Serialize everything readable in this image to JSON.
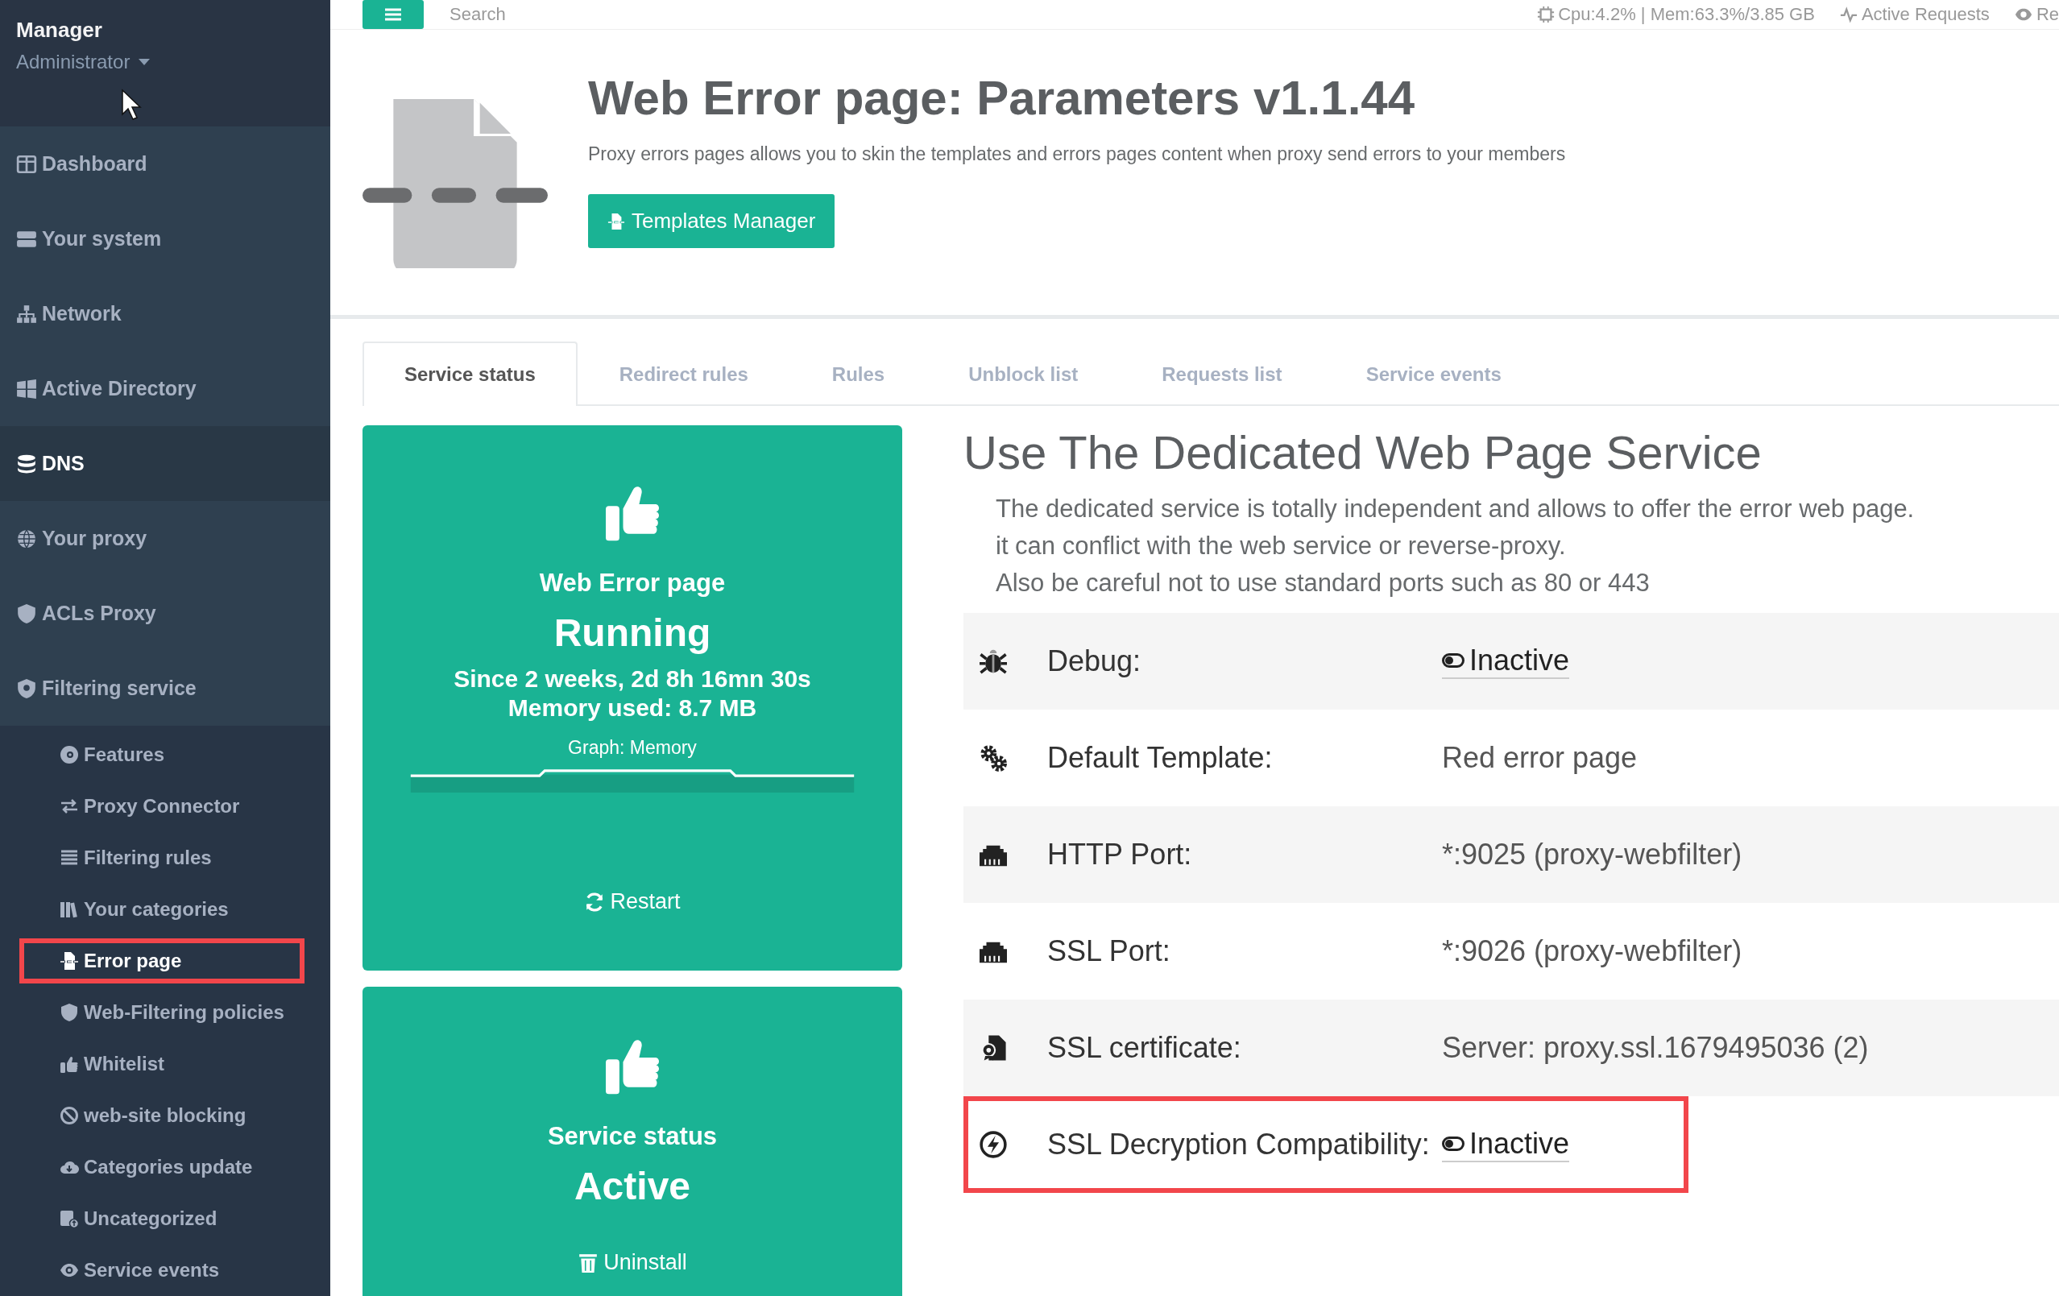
{
  "topbar": {
    "search": {
      "placeholder": "Search"
    },
    "stats": "Cpu:4.2% | Mem:63.3%/3.85 GB",
    "links": [
      "Active Requests",
      "Re"
    ]
  },
  "sidebar": {
    "user": "Manager",
    "role": "Administrator",
    "items": [
      {
        "label": "Dashboard",
        "selected": false
      },
      {
        "label": "Your system",
        "selected": false
      },
      {
        "label": "Network",
        "selected": false
      },
      {
        "label": "Active Directory",
        "selected": false
      },
      {
        "label": "DNS",
        "selected": true
      },
      {
        "label": "Your proxy",
        "selected": false
      },
      {
        "label": "ACLs Proxy",
        "selected": false
      },
      {
        "label": "Filtering service",
        "selected": false,
        "children": [
          {
            "label": "Features",
            "selected": false,
            "highlighted": false
          },
          {
            "label": "Proxy Connector",
            "selected": false,
            "highlighted": false
          },
          {
            "label": "Filtering rules",
            "selected": false,
            "highlighted": false
          },
          {
            "label": "Your categories",
            "selected": false,
            "highlighted": false
          },
          {
            "label": "Error page",
            "selected": true,
            "highlighted": true
          },
          {
            "label": "Web-Filtering policies",
            "selected": false,
            "highlighted": false
          },
          {
            "label": "Whitelist",
            "selected": false,
            "highlighted": false
          },
          {
            "label": "web-site blocking",
            "selected": false,
            "highlighted": false
          },
          {
            "label": "Categories update",
            "selected": false,
            "highlighted": false
          },
          {
            "label": "Uncategorized",
            "selected": false,
            "highlighted": false
          },
          {
            "label": "Service events",
            "selected": false,
            "highlighted": false
          }
        ]
      }
    ]
  },
  "page_header": {
    "title": "Web Error page: Parameters v1.1.44",
    "description": "Proxy errors pages allows you to skin the templates and errors pages content when proxy send errors to your members",
    "button": "Templates Manager"
  },
  "tabs": [
    {
      "label": "Service status",
      "selected": true
    },
    {
      "label": "Redirect rules",
      "selected": false
    },
    {
      "label": "Rules",
      "selected": false
    },
    {
      "label": "Unblock list",
      "selected": false
    },
    {
      "label": "Requests list",
      "selected": false
    },
    {
      "label": "Service events",
      "selected": false
    }
  ],
  "status_cards": [
    {
      "kind": "running",
      "title": "Web Error page",
      "status": "Running",
      "details": [
        "Since 2 weeks, 2d 8h 16mn 30s",
        "Memory used: 8.7 MB"
      ],
      "graph_label": "Graph: Memory",
      "action": "Restart"
    },
    {
      "kind": "active",
      "title": "Service status",
      "status": "Active",
      "action": "Uninstall"
    }
  ],
  "panel": {
    "heading": "Use The Dedicated Web Page Service",
    "lines": [
      "The dedicated service is totally independent and allows to offer the error web page.",
      "it can conflict with the web service or reverse-proxy.",
      "Also be careful not to use standard ports such as 80 or 443"
    ],
    "params": [
      {
        "label": "Debug:",
        "kind": "toggle",
        "on": false,
        "value": "Inactive",
        "highlighted": false
      },
      {
        "label": "Default Template:",
        "kind": "text",
        "value": "Red error page",
        "highlighted": false
      },
      {
        "label": "HTTP Port:",
        "kind": "text",
        "value": "*:9025 (proxy-webfilter)",
        "highlighted": false
      },
      {
        "label": "SSL Port:",
        "kind": "text",
        "value": "*:9026 (proxy-webfilter)",
        "highlighted": false
      },
      {
        "label": "SSL certificate:",
        "kind": "text",
        "value": "Server: proxy.ssl.1679495036 (2)",
        "highlighted": false
      },
      {
        "label": "SSL Decryption Compatibility:",
        "kind": "toggle",
        "on": false,
        "value": "Inactive",
        "highlighted": true
      }
    ]
  }
}
